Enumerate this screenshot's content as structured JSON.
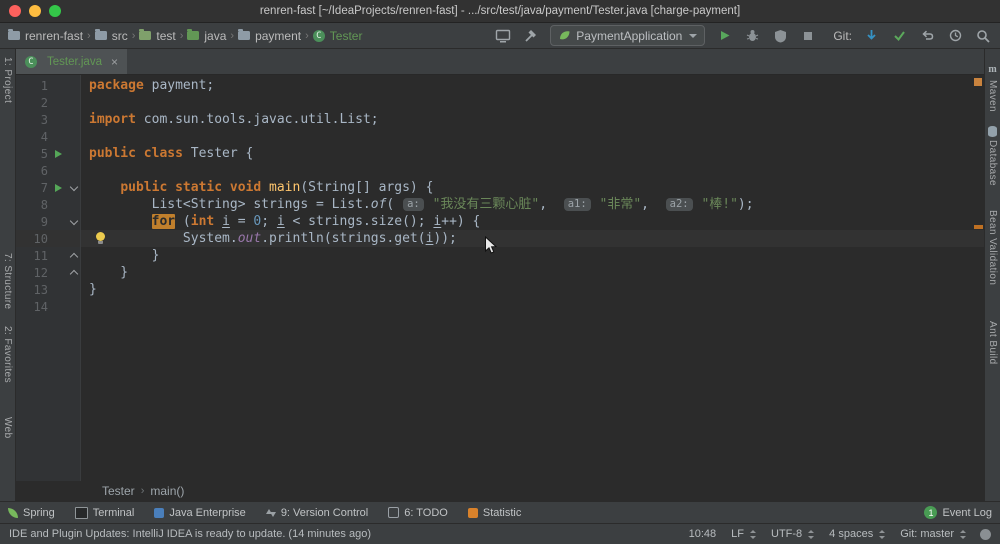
{
  "palette": {
    "editor_bg": "#2b2b2b",
    "panel_bg": "#3c3f41",
    "keyword_orange": "#CC7832",
    "string_green": "#6A8759",
    "number_blue": "#6897BB",
    "method_yellow": "#FFC66D",
    "static_field_purple": "#9876AA",
    "vcs_added_green": "#629755",
    "run_green": "#499C54",
    "warning_orange": "#C9833E"
  },
  "titlebar": {
    "title": "renren-fast [~/IdeaProjects/renren-fast] - .../src/test/java/payment/Tester.java [charge-payment]"
  },
  "toolbar": {
    "breadcrumbs": [
      {
        "label": "renren-fast",
        "icon": "project-folder"
      },
      {
        "label": "src",
        "icon": "folder"
      },
      {
        "label": "test",
        "icon": "test-folder"
      },
      {
        "label": "java",
        "icon": "source-folder"
      },
      {
        "label": "payment",
        "icon": "package-folder"
      },
      {
        "label": "Tester",
        "icon": "class",
        "color": "#629755"
      }
    ],
    "run_config": "PaymentApplication",
    "git_label": "Git:"
  },
  "left_strip": [
    {
      "label": "1: Project"
    },
    {
      "label": "7: Structure"
    },
    {
      "label": "2: Favorites"
    },
    {
      "label": "Web"
    }
  ],
  "right_strip": [
    {
      "label": "Maven",
      "icon": "maven-icon"
    },
    {
      "label": "Database",
      "icon": "database-icon"
    },
    {
      "label": "Bean Validation"
    },
    {
      "label": "Ant Build"
    }
  ],
  "tab": {
    "label": "Tester.java"
  },
  "editor": {
    "active_line": 10,
    "run_lines": [
      5,
      7
    ],
    "fold_open": [
      7,
      9
    ],
    "fold_close": [
      11,
      12
    ],
    "bulb_line": 10,
    "lines": [
      [
        [
          "kw",
          "package"
        ],
        [
          "pl",
          " payment;"
        ]
      ],
      [],
      [
        [
          "kw",
          "import"
        ],
        [
          "pl",
          " com.sun.tools.javac.util.List;"
        ]
      ],
      [],
      [
        [
          "kw",
          "public class"
        ],
        [
          "pl",
          " Tester {"
        ]
      ],
      [],
      [
        [
          "pl",
          "    "
        ],
        [
          "kw",
          "public static void"
        ],
        [
          "pl",
          " "
        ],
        [
          "decl",
          "main"
        ],
        [
          "pl",
          "(String[] args) {"
        ]
      ],
      [
        [
          "pl",
          "        List<String> strings = List."
        ],
        [
          "it",
          "of"
        ],
        [
          "pl",
          "( "
        ],
        [
          "hint",
          "a:"
        ],
        [
          "pl",
          " "
        ],
        [
          "str",
          "\"我没有三颗心脏\""
        ],
        [
          "pl",
          ",  "
        ],
        [
          "hint",
          "a1:"
        ],
        [
          "pl",
          " "
        ],
        [
          "str",
          "\"非常\""
        ],
        [
          "pl",
          ",  "
        ],
        [
          "hint",
          "a2:"
        ],
        [
          "pl",
          " "
        ],
        [
          "str",
          "\"棒!\""
        ],
        [
          "pl",
          ");"
        ]
      ],
      [
        [
          "pl",
          "        "
        ],
        [
          "kwhl",
          "for"
        ],
        [
          "pl",
          " ("
        ],
        [
          "kw",
          "int"
        ],
        [
          "pl",
          " "
        ],
        [
          "u",
          "i"
        ],
        [
          "pl",
          " = "
        ],
        [
          "num",
          "0"
        ],
        [
          "pl",
          "; "
        ],
        [
          "u",
          "i"
        ],
        [
          "pl",
          " < strings.size(); "
        ],
        [
          "u",
          "i"
        ],
        [
          "pl",
          "++) {"
        ]
      ],
      [
        [
          "pl",
          "            System."
        ],
        [
          "field",
          "out"
        ],
        [
          "pl",
          ".println(strings.get("
        ],
        [
          "u",
          "i"
        ],
        [
          "pl",
          "));"
        ]
      ],
      [
        [
          "pl",
          "        }"
        ]
      ],
      [
        [
          "pl",
          "    }"
        ]
      ],
      [
        [
          "pl",
          "}"
        ]
      ],
      []
    ]
  },
  "editor_breadcrumbs": [
    "Tester",
    "main()"
  ],
  "toolwindow_bar": {
    "left": [
      {
        "label": "Spring",
        "icon": "spring-icon"
      },
      {
        "label": "Terminal",
        "icon": "terminal-icon"
      },
      {
        "label": "Java Enterprise",
        "icon": "javaee-icon"
      },
      {
        "label": "9: Version Control",
        "icon": "vcs-icon"
      },
      {
        "label": "6: TODO",
        "icon": "todo-icon"
      },
      {
        "label": "Statistic",
        "icon": "statistic-icon"
      }
    ],
    "event_log": {
      "badge": "1",
      "label": "Event Log"
    }
  },
  "statusbar": {
    "message": "IDE and Plugin Updates: IntelliJ IDEA is ready to update. (14 minutes ago)",
    "widgets": [
      {
        "label": "10:48",
        "dropdown": false
      },
      {
        "label": "LF",
        "dropdown": true
      },
      {
        "label": "UTF-8",
        "dropdown": true
      },
      {
        "label": "4 spaces",
        "dropdown": true
      },
      {
        "label": "Git: master",
        "dropdown": true
      }
    ]
  }
}
